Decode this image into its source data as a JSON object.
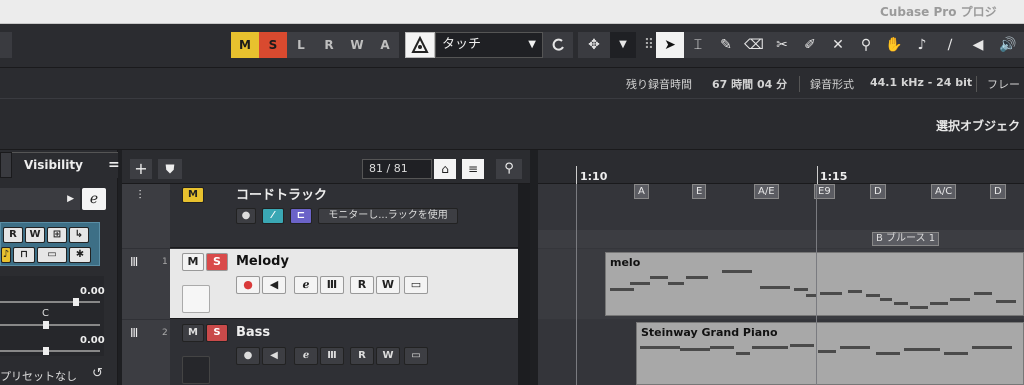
{
  "window": {
    "title": "Cubase Pro プロジ"
  },
  "toolbar": {
    "modes": [
      "M",
      "S",
      "L",
      "R",
      "W",
      "A"
    ],
    "automation_mode": "タッチ"
  },
  "info": {
    "rec_time_label": "残り録音時間",
    "rec_time_value": "67 時間 04 分",
    "rec_format_label": "録音形式",
    "rec_format_value": "44.1 kHz - 24 bit",
    "frame_label": "フレー"
  },
  "selection": {
    "label": "選択オブジェク"
  },
  "inspector": {
    "visibility_tab": "Visibility",
    "eq_label": "=",
    "value1": "0.00",
    "center": "C",
    "value2": "0.00",
    "preset": "プリセットなし"
  },
  "trackpanel": {
    "counter": "81 / 81"
  },
  "tracks": [
    {
      "number": "",
      "name": "コードトラック",
      "monitor_label": "モニターし...ラックを使用"
    },
    {
      "number": "1",
      "name": "Melody",
      "part": "melo"
    },
    {
      "number": "2",
      "name": "Bass",
      "part": "Steinway Grand Piano"
    }
  ],
  "ruler": {
    "bar1": "1:10",
    "bar2": "1:15"
  },
  "chords": [
    "A",
    "E",
    "A/E",
    "E9",
    "D",
    "A/C",
    "D"
  ],
  "scale": "B ブルース 1"
}
